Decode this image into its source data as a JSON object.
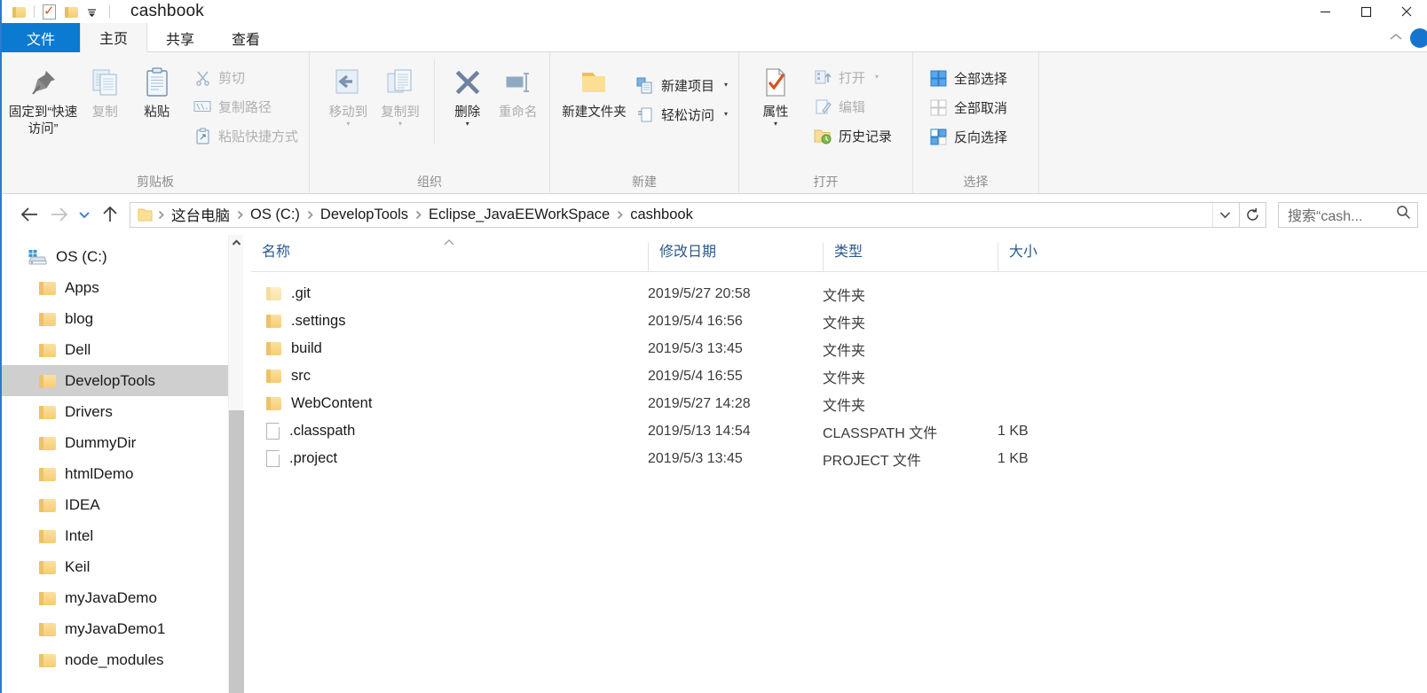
{
  "window": {
    "title": "cashbook",
    "controls": {
      "minimize": "—",
      "maximize": "□",
      "close": "✕"
    }
  },
  "quick_access": {
    "items": [
      {
        "name": "folder-icon",
        "label": ""
      },
      {
        "name": "properties-icon",
        "label": ""
      },
      {
        "name": "new-folder-icon",
        "label": ""
      },
      {
        "name": "customize-dropdown-icon",
        "label": ""
      }
    ]
  },
  "tabs": [
    {
      "label": "文件",
      "id": "file",
      "state": "file"
    },
    {
      "label": "主页",
      "id": "home",
      "state": "active"
    },
    {
      "label": "共享",
      "id": "share",
      "state": "normal"
    },
    {
      "label": "查看",
      "id": "view",
      "state": "normal"
    }
  ],
  "ribbon": {
    "groups": [
      {
        "label": "剪贴板",
        "big": [
          {
            "label": "固定到“快速访问”",
            "icon": "pin-icon",
            "dim": false
          },
          {
            "label": "复制",
            "icon": "copy-icon",
            "dim": true
          },
          {
            "label": "粘贴",
            "icon": "paste-icon",
            "dim": false
          }
        ],
        "small": [
          {
            "label": "剪切",
            "icon": "scissors-icon",
            "dim": true
          },
          {
            "label": "复制路径",
            "icon": "copy-path-icon",
            "dim": true
          },
          {
            "label": "粘贴快捷方式",
            "icon": "paste-shortcut-icon",
            "dim": true
          }
        ]
      },
      {
        "label": "组织",
        "big": [
          {
            "label": "移动到",
            "icon": "move-to-icon",
            "dim": true,
            "caret": true
          },
          {
            "label": "复制到",
            "icon": "copy-to-icon",
            "dim": true,
            "caret": true
          },
          {
            "label": "删除",
            "icon": "delete-icon",
            "dim": false,
            "caret": true
          },
          {
            "label": "重命名",
            "icon": "rename-icon",
            "dim": true
          }
        ],
        "small": []
      },
      {
        "label": "新建",
        "big": [
          {
            "label": "新建文件夹",
            "icon": "new-folder-icon",
            "dim": false
          }
        ],
        "small": [
          {
            "label": "新建项目",
            "icon": "new-item-icon",
            "dim": false,
            "caret": true
          },
          {
            "label": "轻松访问",
            "icon": "easy-access-icon",
            "dim": false,
            "caret": true
          }
        ]
      },
      {
        "label": "打开",
        "big": [
          {
            "label": "属性",
            "icon": "properties-icon",
            "dim": false,
            "caret": true
          }
        ],
        "small": [
          {
            "label": "打开",
            "icon": "open-icon",
            "dim": true,
            "caret": true
          },
          {
            "label": "编辑",
            "icon": "edit-icon",
            "dim": true
          },
          {
            "label": "历史记录",
            "icon": "history-icon",
            "dim": false
          }
        ]
      },
      {
        "label": "选择",
        "big": [],
        "small": [
          {
            "label": "全部选择",
            "icon": "select-all-icon",
            "dim": false
          },
          {
            "label": "全部取消",
            "icon": "select-none-icon",
            "dim": false
          },
          {
            "label": "反向选择",
            "icon": "invert-selection-icon",
            "dim": false
          }
        ]
      }
    ]
  },
  "addressbar": {
    "back": "←",
    "forward": "→",
    "recent": "ˇ",
    "up": "↑",
    "breadcrumbs": [
      "这台电脑",
      "OS (C:)",
      "DevelopTools",
      "Eclipse_JavaEEWorkSpace",
      "cashbook"
    ],
    "separator": "›",
    "dropdown": "ˇ",
    "refresh": "↻"
  },
  "search": {
    "placeholder": "搜索“cash...",
    "icon": "search-icon"
  },
  "navpane": {
    "items": [
      {
        "label": "OS (C:)",
        "icon": "drive-icon",
        "level": 0,
        "selected": false
      },
      {
        "label": "Apps",
        "icon": "folder-icon",
        "level": 1,
        "selected": false
      },
      {
        "label": "blog",
        "icon": "folder-icon",
        "level": 1,
        "selected": false
      },
      {
        "label": "Dell",
        "icon": "folder-icon",
        "level": 1,
        "selected": false
      },
      {
        "label": "DevelopTools",
        "icon": "folder-icon",
        "level": 1,
        "selected": true
      },
      {
        "label": "Drivers",
        "icon": "folder-icon",
        "level": 1,
        "selected": false
      },
      {
        "label": "DummyDir",
        "icon": "folder-icon",
        "level": 1,
        "selected": false
      },
      {
        "label": "htmlDemo",
        "icon": "folder-icon",
        "level": 1,
        "selected": false
      },
      {
        "label": "IDEA",
        "icon": "folder-icon",
        "level": 1,
        "selected": false
      },
      {
        "label": "Intel",
        "icon": "folder-icon",
        "level": 1,
        "selected": false
      },
      {
        "label": "Keil",
        "icon": "folder-icon",
        "level": 1,
        "selected": false
      },
      {
        "label": "myJavaDemo",
        "icon": "folder-icon",
        "level": 1,
        "selected": false
      },
      {
        "label": "myJavaDemo1",
        "icon": "folder-icon",
        "level": 1,
        "selected": false
      },
      {
        "label": "node_modules",
        "icon": "folder-icon",
        "level": 1,
        "selected": false
      }
    ]
  },
  "filelist": {
    "columns": [
      {
        "label": "名称",
        "key": "name"
      },
      {
        "label": "修改日期",
        "key": "date"
      },
      {
        "label": "类型",
        "key": "type"
      },
      {
        "label": "大小",
        "key": "size"
      }
    ],
    "sort": {
      "column": "name",
      "direction": "asc",
      "marker": "∧"
    },
    "rows": [
      {
        "name": ".git",
        "date": "2019/5/27 20:58",
        "type": "文件夹",
        "size": "",
        "icon": "folder-icon",
        "hidden": true
      },
      {
        "name": ".settings",
        "date": "2019/5/4 16:56",
        "type": "文件夹",
        "size": "",
        "icon": "folder-icon",
        "hidden": false
      },
      {
        "name": "build",
        "date": "2019/5/3 13:45",
        "type": "文件夹",
        "size": "",
        "icon": "folder-icon",
        "hidden": false
      },
      {
        "name": "src",
        "date": "2019/5/4 16:55",
        "type": "文件夹",
        "size": "",
        "icon": "folder-icon",
        "hidden": false
      },
      {
        "name": "WebContent",
        "date": "2019/5/27 14:28",
        "type": "文件夹",
        "size": "",
        "icon": "folder-icon",
        "hidden": false
      },
      {
        "name": ".classpath",
        "date": "2019/5/13 14:54",
        "type": "CLASSPATH 文件",
        "size": "1 KB",
        "icon": "file-icon",
        "hidden": false
      },
      {
        "name": ".project",
        "date": "2019/5/3 13:45",
        "type": "PROJECT 文件",
        "size": "1 KB",
        "icon": "file-icon",
        "hidden": false
      }
    ]
  },
  "colors": {
    "accent": "#0b7ad1",
    "selection": "#cfcfcf",
    "header_text": "#2b5a8c",
    "ribbon_bg": "#f6f6f6"
  }
}
